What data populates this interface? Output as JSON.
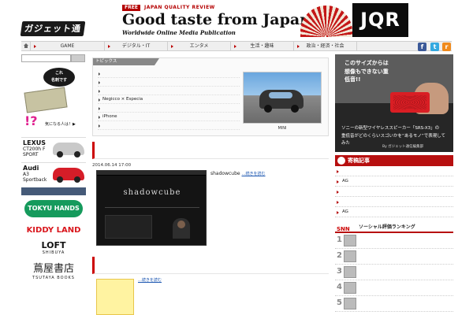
{
  "site": {
    "logo_text": "ガジェット通信"
  },
  "banner": {
    "free_label": "FREE",
    "tag": "JAPAN QUALITY REVIEW",
    "headline": "Good taste from Japan",
    "subline": "Worldwide Online Media Publication",
    "brand": "JQR"
  },
  "social": {
    "facebook": "f",
    "twitter": "t",
    "rss": "r"
  },
  "nav": {
    "items": [
      {
        "label": "GAME"
      },
      {
        "label": "デジタル・IT"
      },
      {
        "label": "エンタメ"
      },
      {
        "label": "生活・趣味"
      },
      {
        "label": "政治・経済・社会"
      }
    ]
  },
  "search": {
    "placeholder": ""
  },
  "left": {
    "mascot_bubble": "これ\n名刺です",
    "mascot_mark": "!?",
    "mascot_caption": "気になる人は！▶",
    "ads": [
      {
        "name": "LEXUS",
        "model": "CT200h F SPORT"
      },
      {
        "name": "Audi",
        "model": "A3 Sportback"
      }
    ],
    "button_label": "",
    "logos": {
      "tokyu": "TOKYU HANDS",
      "kiddy": "KIDDY LAND",
      "loft_main": "LOFT",
      "loft_sub": "SHIBUYA",
      "tsutaya_main": "蔦屋書店",
      "tsutaya_sub": "TSUTAYA BOOKS"
    }
  },
  "topics": {
    "header": "トピックス",
    "items": [
      {
        "text": ""
      },
      {
        "text": ""
      },
      {
        "text": ""
      },
      {
        "text": "Negicco × Especia"
      },
      {
        "text": ""
      },
      {
        "text": "iPhone"
      },
      {
        "text": ""
      }
    ],
    "photo_caption": "MINI"
  },
  "articles": [
    {
      "title": "",
      "date": "2014.06.14 17:00",
      "thumb_word": "shadowcube",
      "thumb_sub": "",
      "text": "shadowcube",
      "more": "…続きを読む"
    },
    {
      "title": "",
      "text": "",
      "more": "…続きを読む",
      "thumb_text": ""
    }
  ],
  "right": {
    "sony_ad": {
      "h1": "このサイズからは",
      "h2": "想像もできない重低音!!",
      "c1": "ソニーの新型ワイヤレススピーカー「SRS-X3」の",
      "c2": "重低音がどのくらいスゴいかを“あるモノ”で表現してみた",
      "c3": "By ガジェット通信編集部"
    },
    "contrib_header": "寄稿記事",
    "contrib_items": [
      {
        "text": ""
      },
      {
        "text": "AG"
      },
      {
        "text": ""
      },
      {
        "text": ""
      },
      {
        "text": "AG"
      }
    ],
    "social_logo": "SNN",
    "social_header": "ソーシャル評価ランキング",
    "ranking": [
      {
        "num": "1",
        "text": ""
      },
      {
        "num": "2",
        "text": ""
      },
      {
        "num": "3",
        "text": ""
      },
      {
        "num": "4",
        "text": ""
      },
      {
        "num": "5",
        "text": ""
      }
    ]
  }
}
